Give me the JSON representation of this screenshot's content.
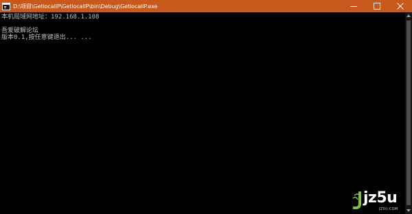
{
  "window": {
    "title": "D:\\项目\\GetlocalIP\\GetlocalIP\\bin\\Debug\\GetlocalIP.exe",
    "titlebar_color": "#c8581c",
    "controls": {
      "minimize_icon": "minimize-icon",
      "maximize_icon": "maximize-icon",
      "close_icon": "close-icon"
    }
  },
  "console": {
    "background": "#000000",
    "text_color": "#c0c0c0",
    "lines": [
      "本机局域网地址：192.168.1.108",
      "",
      "吾爱破解论坛",
      "版本0.1,按任意键退出... ..."
    ]
  },
  "watermark": {
    "logo_text": "jz5u",
    "sub_text": "JZ5U.COM",
    "accent_color": "#7cc242"
  }
}
